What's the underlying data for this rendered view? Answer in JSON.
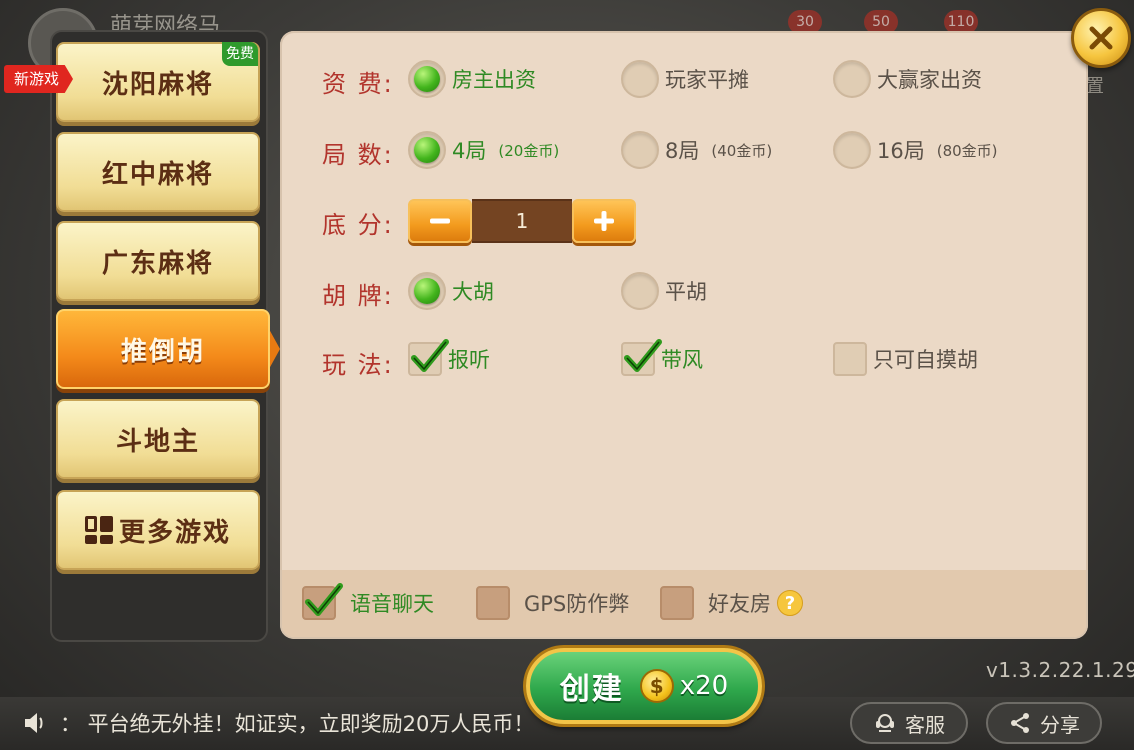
{
  "background": {
    "username": "萌芽网络马...",
    "badges": [
      "30",
      "50",
      "110"
    ],
    "right_label": "置",
    "version": "v1.3.2.22.1.29",
    "marquee": "：  平台绝无外挂！如证实，立即奖励20万人民币！",
    "service_label": "客服",
    "share_label": "分享"
  },
  "games": {
    "items": [
      {
        "label": "沈阳麻将",
        "tag": "免费"
      },
      {
        "label": "红中麻将"
      },
      {
        "label": "广东麻将"
      },
      {
        "label": "推倒胡",
        "active": true
      },
      {
        "label": "斗地主"
      },
      {
        "label": "更多游戏"
      }
    ],
    "new_tag": "新游戏"
  },
  "settings": {
    "fee": {
      "label": "资   费:",
      "options": [
        {
          "label": "房主出资",
          "selected": true
        },
        {
          "label": "玩家平摊",
          "selected": false
        },
        {
          "label": "大赢家出资",
          "selected": false
        }
      ]
    },
    "rounds": {
      "label": "局   数:",
      "options": [
        {
          "label": "4局",
          "note": "(20金币)",
          "selected": true
        },
        {
          "label": "8局",
          "note": "(40金币)",
          "selected": false
        },
        {
          "label": "16局",
          "note": "(80金币)",
          "selected": false
        }
      ]
    },
    "base": {
      "label": "底   分:",
      "value": "1"
    },
    "hu": {
      "label": "胡   牌:",
      "options": [
        {
          "label": "大胡",
          "selected": true
        },
        {
          "label": "平胡",
          "selected": false
        }
      ]
    },
    "play": {
      "label": "玩   法:",
      "options": [
        {
          "label": "报听",
          "checked": true
        },
        {
          "label": "带风",
          "checked": true
        },
        {
          "label": "只可自摸胡",
          "checked": false
        }
      ]
    },
    "footer": {
      "voice_chat": {
        "label": "语音聊天",
        "checked": true
      },
      "gps": {
        "label": "GPS防作弊",
        "checked": false
      },
      "friends": {
        "label": "好友房",
        "checked": false,
        "help": "?"
      }
    }
  },
  "create": {
    "label": "创建",
    "coin_symbol": "$",
    "cost": "x20"
  },
  "colors": {
    "accent_orange": "#f48a1a",
    "selected_green": "#2f8a24",
    "label_red": "#b2342c",
    "panel_bg": "#ebd9c6"
  }
}
